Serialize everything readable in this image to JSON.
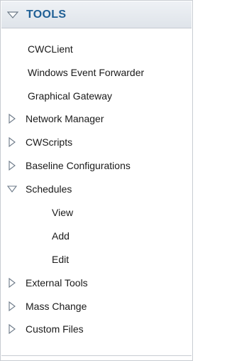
{
  "header": {
    "title": "TOOLS",
    "toggle_icon": "collapse-triangle-icon"
  },
  "colors": {
    "header_text": "#1f5f95",
    "header_bg": "#dfe4ea",
    "border": "#c8ccd2",
    "item_text": "#1a1a1a"
  },
  "items": [
    {
      "label": "CWCLient",
      "type": "leaf",
      "level": 0
    },
    {
      "label": "Windows Event Forwarder",
      "type": "leaf",
      "level": 0
    },
    {
      "label": "Graphical Gateway",
      "type": "leaf",
      "level": 0
    },
    {
      "label": "Network Manager",
      "type": "branch",
      "expanded": false,
      "level": 0
    },
    {
      "label": "CWScripts",
      "type": "branch",
      "expanded": false,
      "level": 0
    },
    {
      "label": "Baseline Configurations",
      "type": "branch",
      "expanded": false,
      "level": 0
    },
    {
      "label": "Schedules",
      "type": "branch",
      "expanded": true,
      "level": 0
    },
    {
      "label": "View",
      "type": "leaf",
      "level": 1
    },
    {
      "label": "Add",
      "type": "leaf",
      "level": 1
    },
    {
      "label": "Edit",
      "type": "leaf",
      "level": 1
    },
    {
      "label": "External Tools",
      "type": "branch",
      "expanded": false,
      "level": 0
    },
    {
      "label": "Mass Change",
      "type": "branch",
      "expanded": false,
      "level": 0
    },
    {
      "label": "Custom Files",
      "type": "branch",
      "expanded": false,
      "level": 0
    }
  ]
}
